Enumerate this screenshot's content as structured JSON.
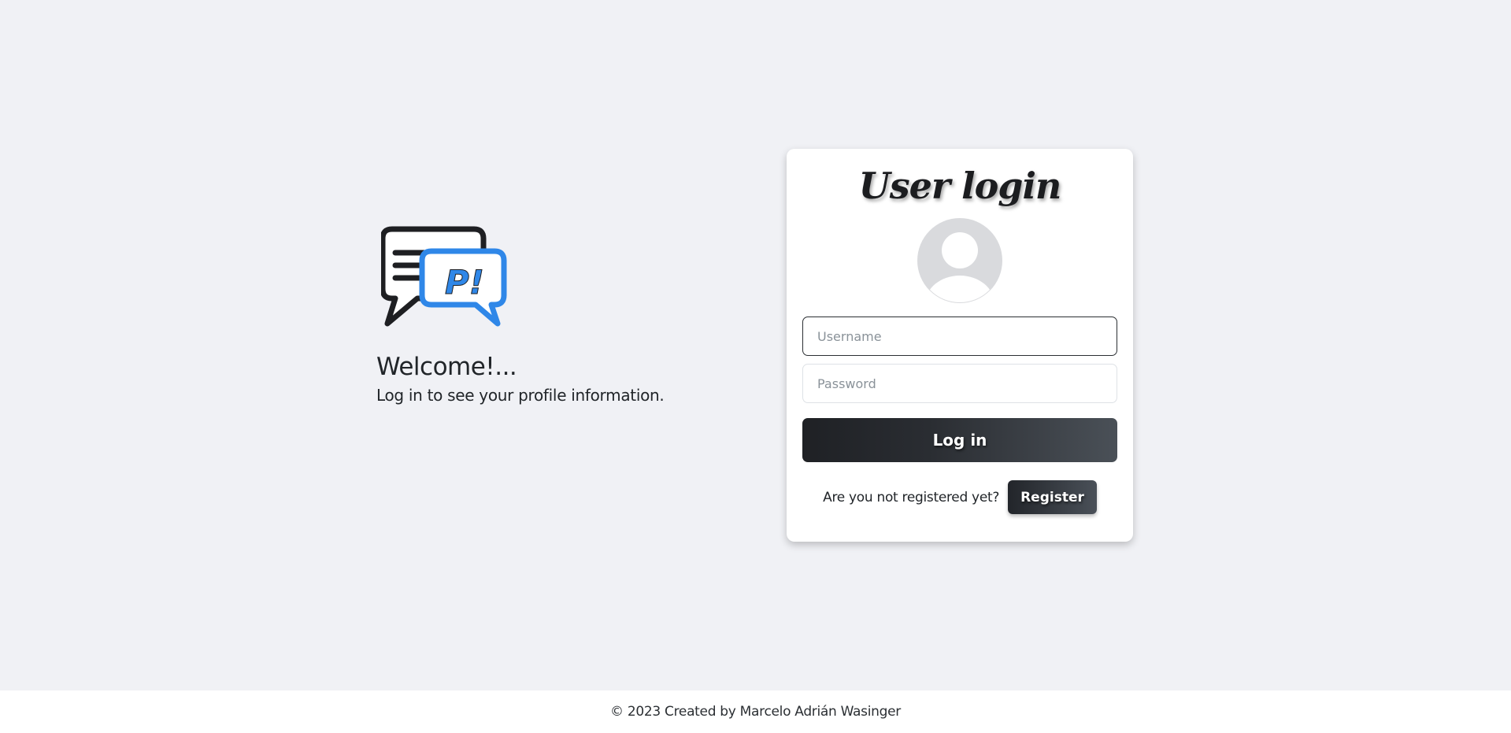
{
  "intro": {
    "logo_icon": "chat-bubbles-logo-icon",
    "logo_text": "P!",
    "title": "Welcome!...",
    "subtitle": "Log in to see your profile information."
  },
  "login": {
    "title": "User login",
    "avatar_icon": "user-avatar-icon",
    "username_placeholder": "Username",
    "username_value": "",
    "password_placeholder": "Password",
    "password_value": "",
    "submit_label": "Log in",
    "register_prompt": "Are you not registered yet?",
    "register_label": "Register"
  },
  "footer": {
    "text": "© 2023 Created by Marcelo Adrián Wasinger"
  },
  "colors": {
    "background": "#f0f1f5",
    "card": "#ffffff",
    "accent_blue": "#2f87e8",
    "dark": "#212529"
  }
}
